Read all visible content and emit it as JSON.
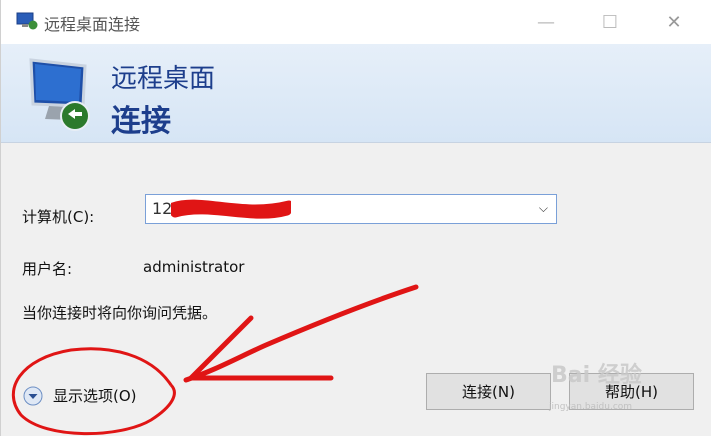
{
  "window": {
    "title": "远程桌面连接",
    "controls": {
      "minimize": "—",
      "maximize": "☐",
      "close": "✕"
    }
  },
  "banner": {
    "title_line1": "远程桌面",
    "title_line2": "连接"
  },
  "form": {
    "computer_label": "计算机(C):",
    "computer_value": "123.207",
    "username_label": "用户名:",
    "username_value": "administrator",
    "notice": "当你连接时将向你询问凭据。"
  },
  "footer": {
    "options_label": "显示选项(O)",
    "connect_label": "连接(N)",
    "help_label": "帮助(H)"
  },
  "watermark": {
    "text": "Bai 经验",
    "sub": "jingyan.baidu.com"
  },
  "colors": {
    "banner_text": "#1d3e8c",
    "annotation": "#e01515"
  }
}
